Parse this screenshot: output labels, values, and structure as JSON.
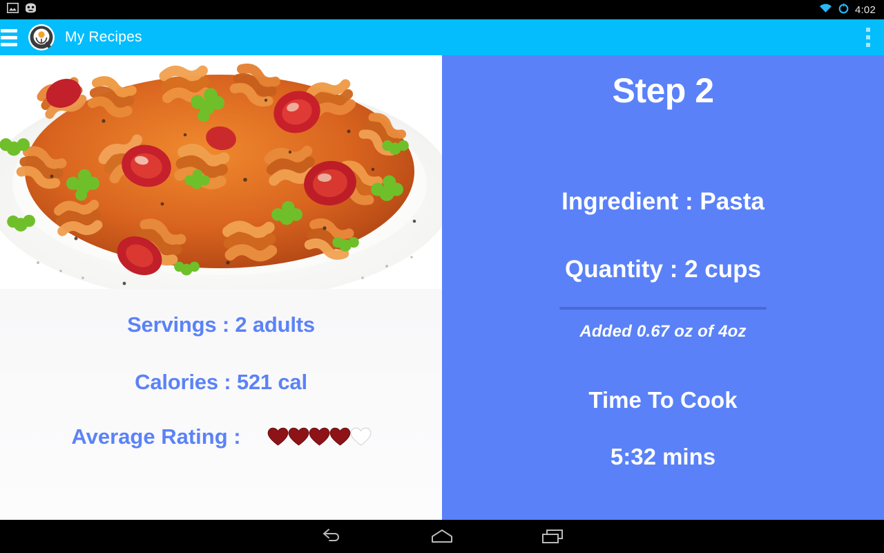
{
  "statusbar": {
    "icons": [
      "photo-icon",
      "cyanogenmod-icon",
      "wifi-icon",
      "battery-icon"
    ],
    "time": "4:02"
  },
  "appbar": {
    "menu_icon": "hamburger-menu-icon",
    "logo_icon": "app-logo-icon",
    "title": "My Recipes",
    "overflow_icon": "overflow-menu-icon",
    "background_color": "#03bdfd"
  },
  "recipe": {
    "photo_alt": "fusilli-pasta-with-tomato-sauce",
    "servings": "Servings : 2 adults",
    "calories": "Calories : 521 cal",
    "rating_label": "Average Rating :",
    "rating_filled": 4,
    "rating_total": 5,
    "heart_filled_color": "#8e1316",
    "heart_empty_color": "#ffffff",
    "text_color": "#5b82f7"
  },
  "step_panel": {
    "title": "Step 2",
    "ingredient": "Ingredient : Pasta",
    "quantity": "Quantity : 2 cups",
    "added_note": "Added 0.67 oz of 4oz",
    "cook_label": "Time To Cook",
    "cook_time": "5:32 mins",
    "background_color": "#5a81f8",
    "divider_color": "#4a6ad0"
  },
  "navbar": {
    "back_icon": "back-arrow-icon",
    "home_icon": "home-icon",
    "recents_icon": "recents-icon"
  }
}
